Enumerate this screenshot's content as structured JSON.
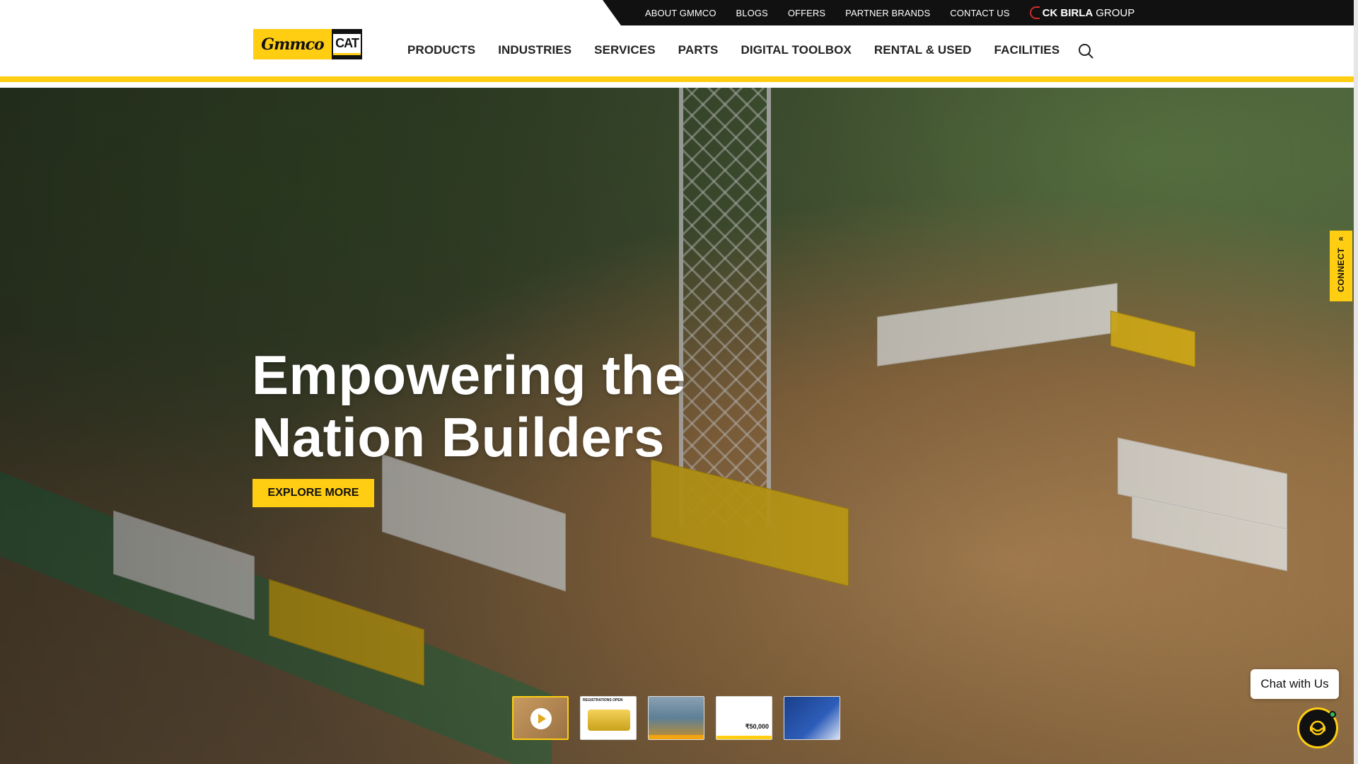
{
  "topbar": {
    "links": [
      "ABOUT GMMCO",
      "BLOGS",
      "OFFERS",
      "PARTNER BRANDS",
      "CONTACT US"
    ],
    "group_brand": "CK BIRLA",
    "group_suffix": "GROUP"
  },
  "logo": {
    "gmmco": "Gmmco",
    "cat": "CAT"
  },
  "nav": {
    "items": [
      "PRODUCTS",
      "INDUSTRIES",
      "SERVICES",
      "PARTS",
      "DIGITAL TOOLBOX",
      "RENTAL & USED",
      "FACILITIES"
    ]
  },
  "hero": {
    "title_line1": "Empowering the",
    "title_line2": "Nation Builders",
    "cta": "EXPLORE MORE"
  },
  "thumbnails": {
    "thumb2_caption": "REGISTRATIONS OPEN",
    "thumb4_amount": "₹50,000"
  },
  "connect": {
    "label": "CONNECT"
  },
  "chat": {
    "label": "Chat with Us"
  },
  "colors": {
    "brand_yellow": "#ffcd11",
    "dark": "#111111"
  }
}
